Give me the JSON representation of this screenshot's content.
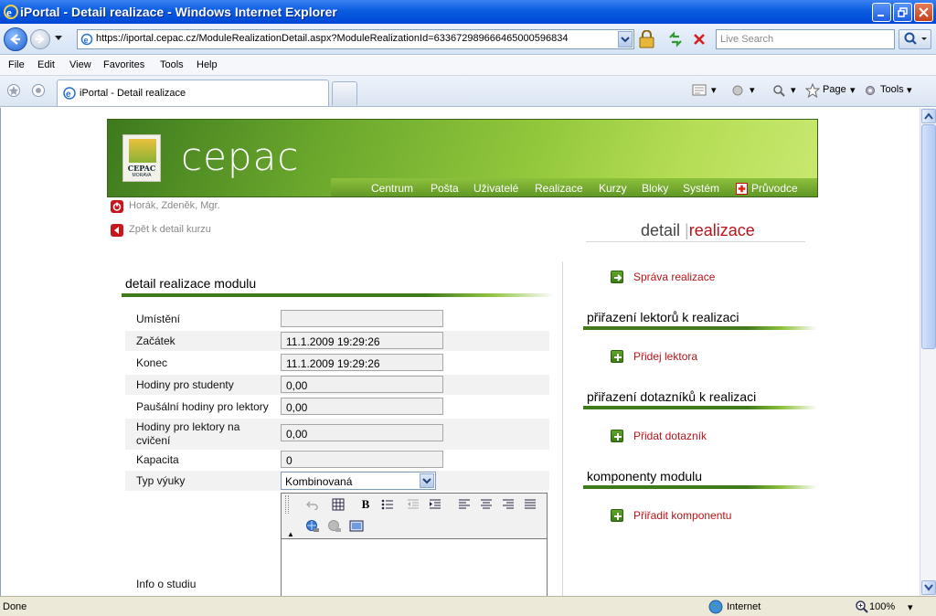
{
  "window": {
    "title": "iPortal - Detail realizace - Windows Internet Explorer"
  },
  "address": {
    "url": "https://iportal.cepac.cz/ModuleRealizationDetail.aspx?ModuleRealizationId=633672989666465000596834",
    "search_placeholder": "Live Search"
  },
  "menu": [
    "File",
    "Edit",
    "View",
    "Favorites",
    "Tools",
    "Help"
  ],
  "tab": {
    "label": "iPortal - Detail realizace"
  },
  "commands": {
    "page": "Page",
    "tools": "Tools"
  },
  "status": {
    "text": "Done",
    "zone": "Internet",
    "zoom": "100%"
  },
  "site": {
    "brand": "cepac",
    "logo_text": "CEPAC",
    "logo_sub": "MORAVA",
    "nav": [
      "Centrum",
      "Pošta",
      "Uživatelé",
      "Realizace",
      "Kurzy",
      "Bloky",
      "Systém",
      "Průvodce"
    ],
    "user": "Horák, Zdeněk, Mgr.",
    "back_link": "Zpět k detail kurzu",
    "page_title_1": "detail",
    "page_title_sep": "|",
    "page_title_2": "realizace"
  },
  "form": {
    "header": "detail realizace modulu",
    "fields": [
      {
        "label": "Umístění",
        "value": ""
      },
      {
        "label": "Začátek",
        "value": "11.1.2009 19:29:26"
      },
      {
        "label": "Konec",
        "value": "11.1.2009 19:29:26"
      },
      {
        "label": "Hodiny pro studenty",
        "value": "0,00"
      },
      {
        "label": "Paušální hodiny pro lektory",
        "value": "0,00"
      },
      {
        "label": "Hodiny pro lektory na",
        "label2": "cvičení",
        "value": "0,00"
      },
      {
        "label": "Kapacita",
        "value": "0"
      }
    ],
    "type_label": "Typ výuky",
    "type_value": "Kombinovaná",
    "info_label": "Info o studiu"
  },
  "side": {
    "manage_link": "Správa realizace",
    "sections": [
      {
        "header": "přiřazení lektorů k realizaci",
        "link": "Přidej lektora"
      },
      {
        "header": "přiřazení dotazníků k realizaci",
        "link": "Přidat dotazník"
      },
      {
        "header": "komponenty modulu",
        "link": "Přiřadit komponentu"
      }
    ]
  },
  "colors": {
    "brand_green": "#5c9424",
    "accent_red": "#b8141a",
    "xp_blue": "#0a5ce0"
  }
}
